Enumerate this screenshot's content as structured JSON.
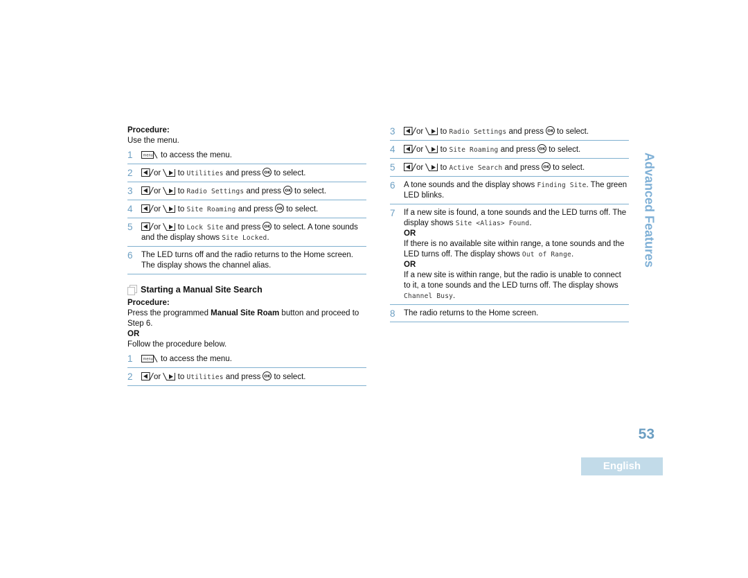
{
  "left": {
    "procedure1": {
      "label": "Procedure:",
      "intro": "Use the menu.",
      "steps": [
        {
          "num": "1",
          "text": "to access the menu."
        },
        {
          "num": "2",
          "or": "or",
          "to": "to",
          "target": "Utilities",
          "press": "and press",
          "tail": "to select."
        },
        {
          "num": "3",
          "or": "or",
          "to": "to",
          "target": "Radio Settings",
          "press": "and press",
          "tail": "to select."
        },
        {
          "num": "4",
          "or": "or",
          "to": "to",
          "target": "Site Roaming",
          "press": "and press",
          "tail": "to select."
        },
        {
          "num": "5",
          "or": "or",
          "to": "to",
          "target": "Lock Site",
          "press": "and press",
          "tail": "to select. A tone sounds and the display shows",
          "display": "Site Locked",
          "end": "."
        },
        {
          "num": "6",
          "text": "The LED turns off and the radio returns to the Home screen. The display shows the channel alias."
        }
      ]
    },
    "section": {
      "title": "Starting a Manual Site Search",
      "procedure_label": "Procedure:",
      "intro_pre": "Press the programmed ",
      "intro_bold": "Manual Site Roam",
      "intro_post": " button and proceed to Step 6.",
      "or": "OR",
      "follow": "Follow the procedure below.",
      "steps": [
        {
          "num": "1",
          "text": "to access the menu."
        },
        {
          "num": "2",
          "or": "or",
          "to": "to",
          "target": "Utilities",
          "press": "and press",
          "tail": "to select."
        }
      ]
    }
  },
  "right": {
    "steps": [
      {
        "num": "3",
        "or": "or",
        "to": "to",
        "target": "Radio Settings",
        "press": "and press",
        "tail": "to select."
      },
      {
        "num": "4",
        "or": "or",
        "to": "to",
        "target": "Site Roaming",
        "press": "and press",
        "tail": "to select."
      },
      {
        "num": "5",
        "or": "or",
        "to": "to",
        "target": "Active Search",
        "press": "and press",
        "tail": "to select."
      },
      {
        "num": "6",
        "text": "A tone sounds and the display shows",
        "display": "Finding Site",
        "text2": ". The green LED blinks."
      },
      {
        "num": "7",
        "a_text": "If a new site is found, a tone sounds and the LED turns off. The display shows",
        "a_display": "Site <Alias> Found",
        "or1": "OR",
        "b_text": "If there is no available site within range, a tone sounds and the LED turns off. The display shows",
        "b_display": "Out of Range",
        "or2": "OR",
        "c_text": "If a new site is within range, but the radio is unable to connect to it, a tone sounds and the LED turns off. The display shows",
        "c_display": "Channel Busy"
      },
      {
        "num": "8",
        "text": "The radio returns to the Home screen."
      }
    ]
  },
  "side_tab": "Advanced Features",
  "page_number": "53",
  "language": "English",
  "icons": {
    "menu_key": "menu-key-icon",
    "left_key": "left-arrow-key-icon",
    "right_key": "right-arrow-key-icon",
    "ok_key": "ok-key-icon",
    "section": "section-page-icon"
  },
  "colors": {
    "accent": "#6b9ec2",
    "divider": "#7fb0cf",
    "side_tab": "#7fb0d6",
    "badge_bg": "#c2dbe9"
  }
}
